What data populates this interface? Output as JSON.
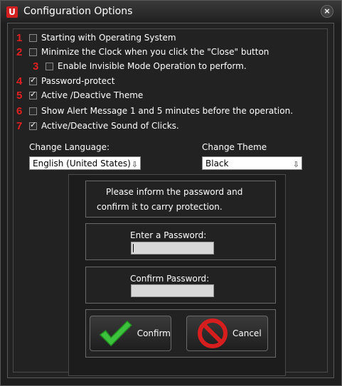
{
  "window": {
    "title": "Configuration Options",
    "app_icon_glyph": "U",
    "close_glyph": "×"
  },
  "options": [
    {
      "number": "1",
      "label": "Starting with Operating System",
      "checked": false
    },
    {
      "number": "2",
      "label": "Minimize the Clock when you click the \"Close\" button",
      "checked": false
    },
    {
      "number": "3",
      "label": "Enable Invisible Mode Operation to perform.",
      "checked": false
    },
    {
      "number": "4",
      "label": "Password-protect",
      "checked": true
    },
    {
      "number": "5",
      "label": "Active /Deactive  Theme",
      "checked": true
    },
    {
      "number": "6",
      "label": "Show Alert Message 1 and 5 minutes before the operation.",
      "checked": false
    },
    {
      "number": "7",
      "label": "Active/Deactive Sound of Clicks.",
      "checked": true
    }
  ],
  "language": {
    "label": "Change Language:",
    "value": "English (United States)"
  },
  "theme": {
    "label": "Change Theme",
    "value": "Black"
  },
  "password": {
    "info_line1": "Please inform the password and",
    "info_line2": "confirm it to carry protection.",
    "enter_label": "Enter a Password:",
    "confirm_label": "Confirm Password:",
    "enter_value": "",
    "confirm_value": ""
  },
  "buttons": {
    "confirm_label": "Confirm",
    "cancel_label": "Cancel"
  },
  "colors": {
    "accent_red": "#e02020",
    "confirm_green": "#3cc23c",
    "cancel_red": "#d61e1e"
  },
  "icons": {
    "check": "check-icon",
    "cancel": "no-entry-icon",
    "dropdown": "chevron-down-icon"
  }
}
